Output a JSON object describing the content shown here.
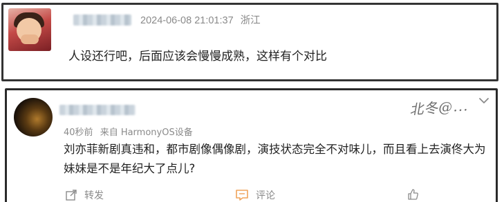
{
  "comment1": {
    "timestamp": "2024-06-08 21:01:37",
    "location": "浙江",
    "text": "人设还行吧，后面应该会慢慢成熟，这样有个对比"
  },
  "comment2": {
    "time_ago": "40秒前",
    "source": "来自 HarmonyOS设备",
    "text": "刘亦菲新剧真违和，都市剧像偶像剧，演技状态完全不对味儿，而且看上去演佟大为妹妹是不是年纪大了点儿?",
    "actions": {
      "forward": "转发",
      "comment": "评论"
    },
    "watermark": "北冬@..."
  },
  "icons": {
    "forward": "share-icon",
    "comment": "comment-icon",
    "like": "like-icon",
    "expand": "chevron-down-icon"
  },
  "colors": {
    "meta_text": "#8a8a8a",
    "comment_icon": "#f0a35a",
    "border": "#333333"
  }
}
